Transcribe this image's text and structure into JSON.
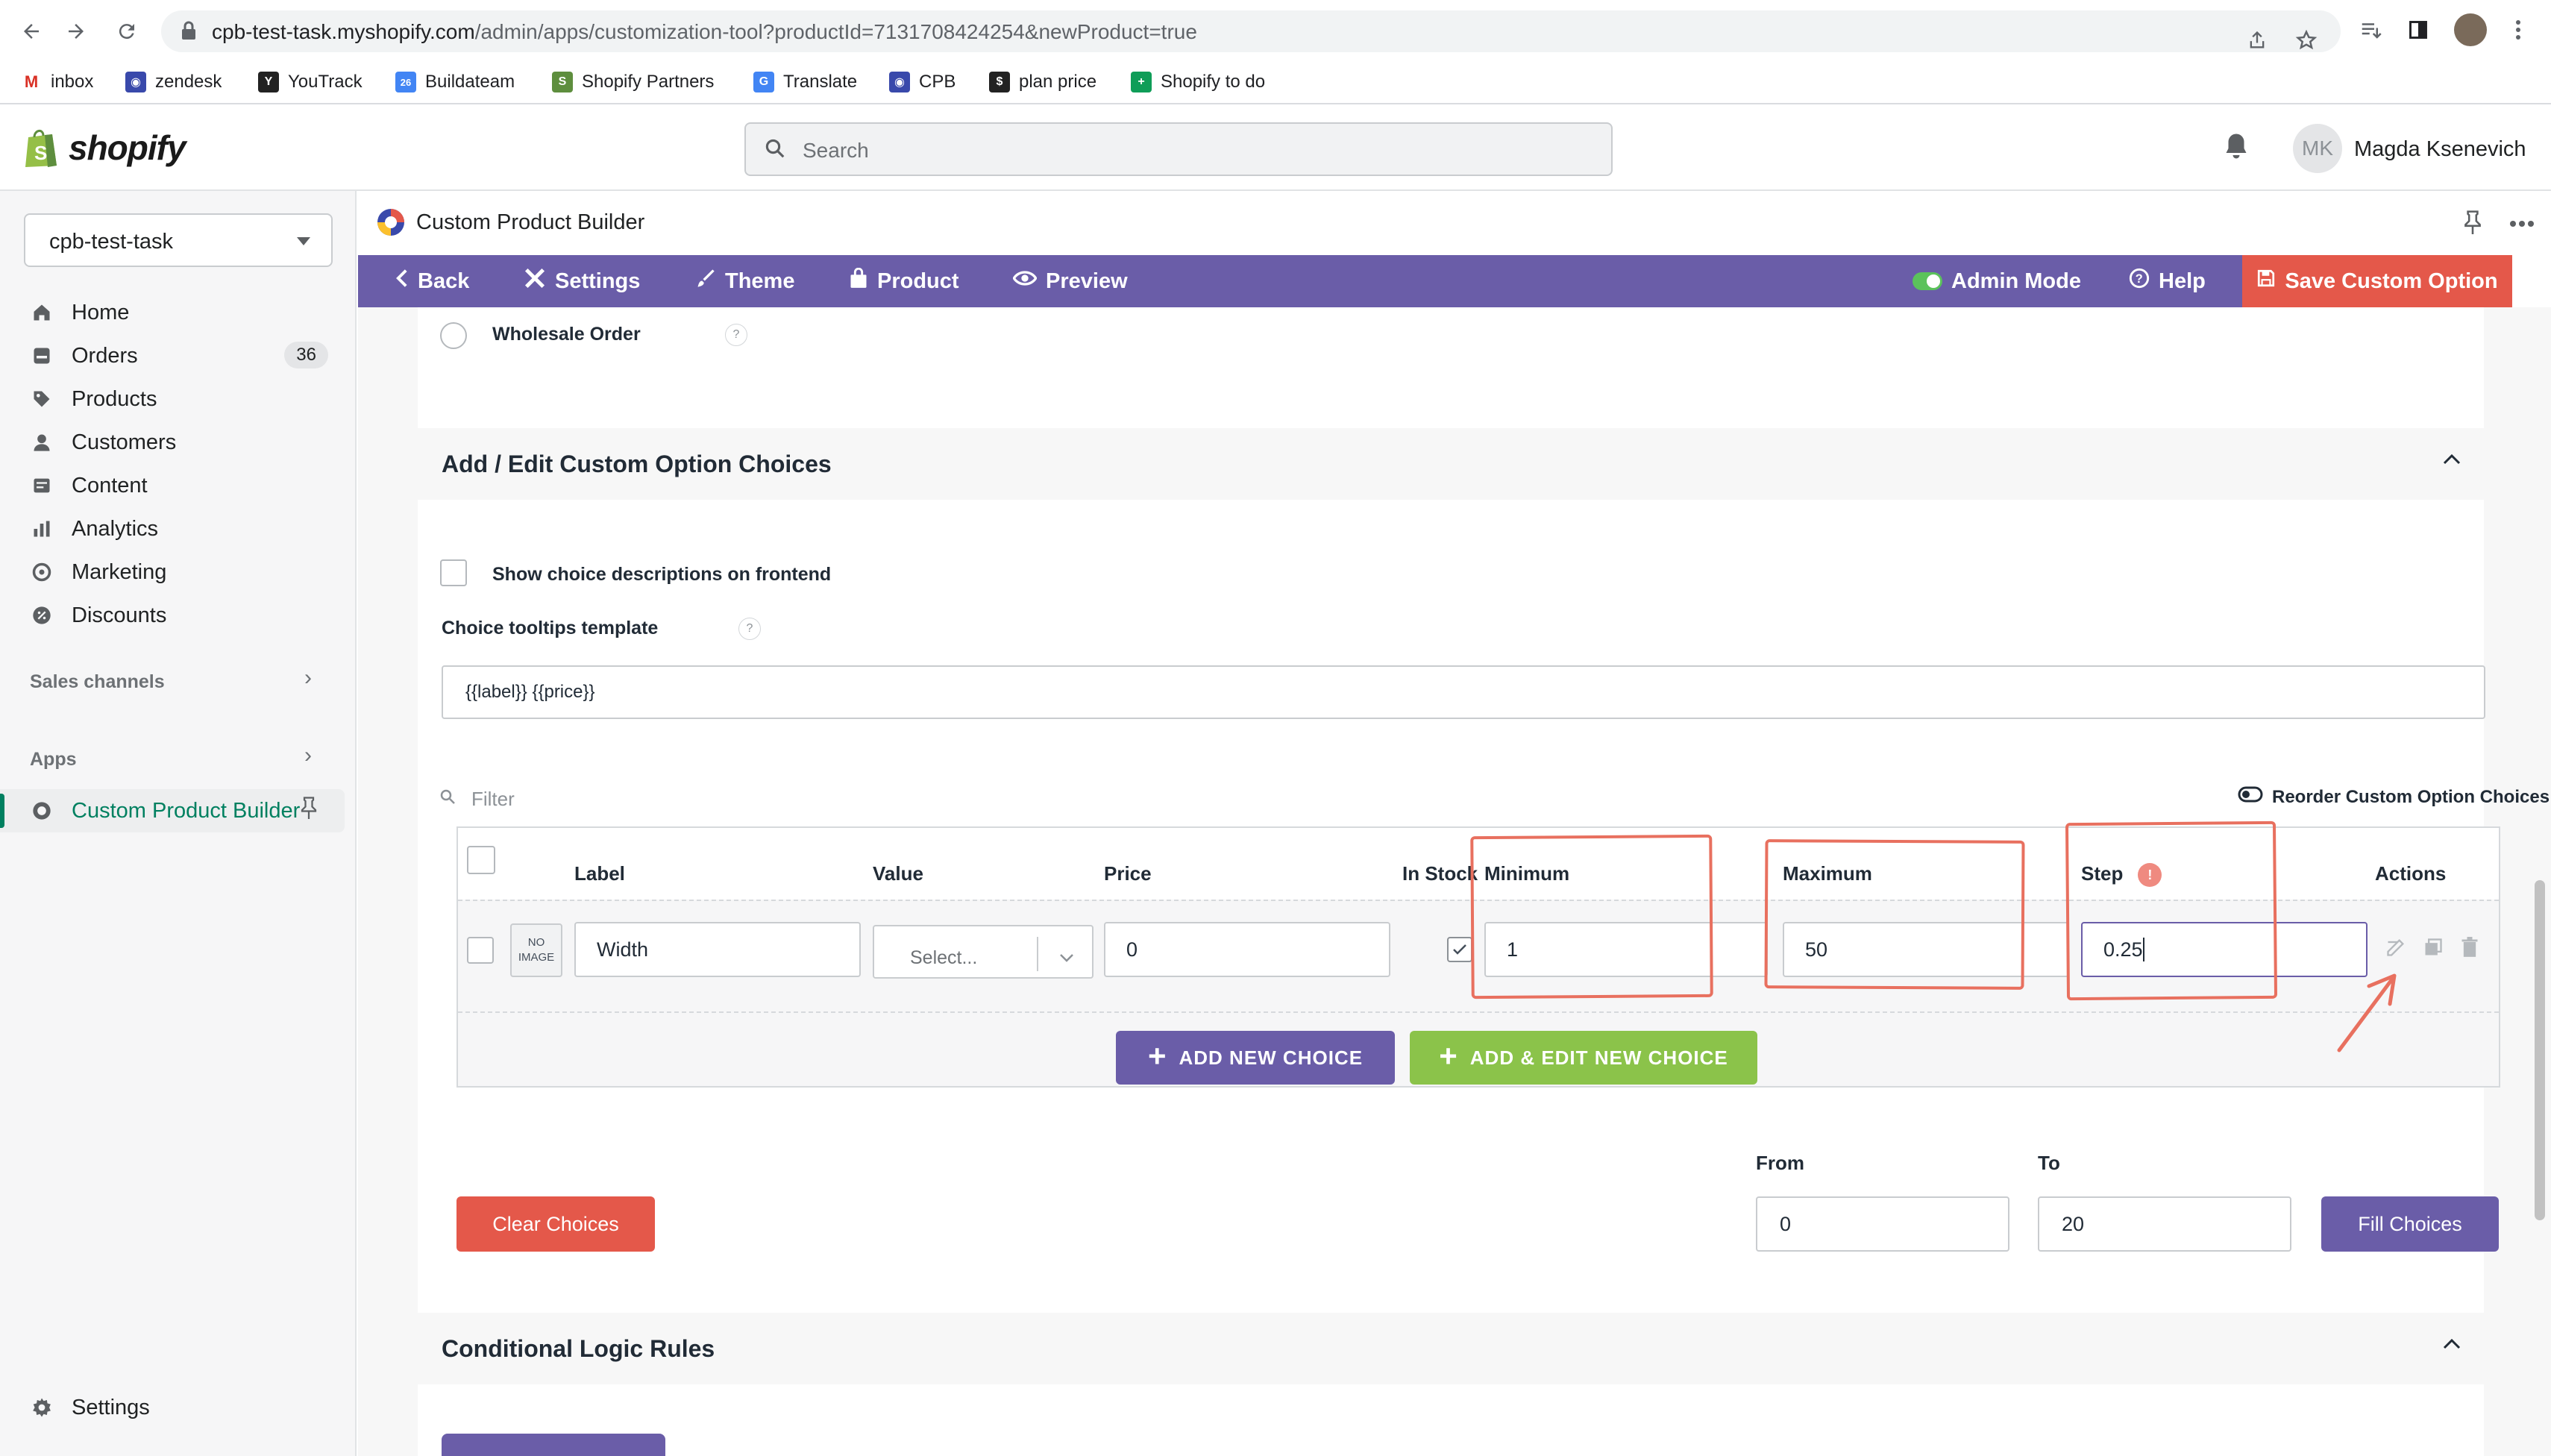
{
  "browser": {
    "url_host": "cpb-test-task.myshopify.com",
    "url_path": "/admin/apps/customization-tool?productId=7131708424254&newProduct=true",
    "bookmarks": [
      {
        "label": "inbox",
        "icon": "gmail-icon",
        "color": "#d93025"
      },
      {
        "label": "zendesk",
        "icon": "zendesk-icon",
        "color": "#3949ab"
      },
      {
        "label": "YouTrack",
        "icon": "youtrack-icon",
        "color": "#000000"
      },
      {
        "label": "Buildateam",
        "icon": "buildateam-icon",
        "color": "#4285f4"
      },
      {
        "label": "Shopify Partners",
        "icon": "shopify-icon",
        "color": "#5e8e3e"
      },
      {
        "label": "Translate",
        "icon": "translate-icon",
        "color": "#4285f4"
      },
      {
        "label": "CPB",
        "icon": "cpb-icon",
        "color": "#3949ab"
      },
      {
        "label": "plan price",
        "icon": "price-icon",
        "color": "#000000"
      },
      {
        "label": "Shopify to do",
        "icon": "sheets-icon",
        "color": "#0f9d58"
      }
    ]
  },
  "shopify": {
    "logo_text": "shopify",
    "search_placeholder": "Search",
    "user_initials": "MK",
    "user_name": "Magda Ksenevich"
  },
  "sidebar": {
    "store": "cpb-test-task",
    "items": [
      {
        "label": "Home",
        "icon": "home-icon"
      },
      {
        "label": "Orders",
        "icon": "orders-icon",
        "badge": "36"
      },
      {
        "label": "Products",
        "icon": "tag-icon"
      },
      {
        "label": "Customers",
        "icon": "person-icon"
      },
      {
        "label": "Content",
        "icon": "content-icon"
      },
      {
        "label": "Analytics",
        "icon": "bar-chart-icon"
      },
      {
        "label": "Marketing",
        "icon": "target-icon"
      },
      {
        "label": "Discounts",
        "icon": "discount-icon"
      }
    ],
    "sales_channels": "Sales channels",
    "apps": "Apps",
    "active_app": "Custom Product Builder",
    "settings": "Settings"
  },
  "app": {
    "title": "Custom Product Builder",
    "toolbar": {
      "back": "Back",
      "settings": "Settings",
      "theme": "Theme",
      "product": "Product",
      "preview": "Preview",
      "admin_mode": "Admin Mode",
      "help": "Help",
      "save": "Save Custom Option"
    }
  },
  "content": {
    "wholesale_order": "Wholesale Order",
    "choices_section_title": "Add / Edit Custom Option Choices",
    "show_descriptions": "Show choice descriptions on frontend",
    "tooltips_label": "Choice tooltips template",
    "tooltips_value": "{{label}} {{price}}",
    "filter": "Filter",
    "reorder": "Reorder Custom Option Choices",
    "columns": {
      "label": "Label",
      "value": "Value",
      "price": "Price",
      "in_stock": "In Stock",
      "minimum": "Minimum",
      "maximum": "Maximum",
      "step": "Step",
      "actions": "Actions"
    },
    "row": {
      "no_image_line1": "NO",
      "no_image_line2": "IMAGE",
      "label": "Width",
      "value_placeholder": "Select...",
      "price": "0",
      "minimum": "1",
      "maximum": "50",
      "step": "0.25"
    },
    "add_new_choice": "ADD NEW CHOICE",
    "add_edit_new_choice": "ADD & EDIT NEW CHOICE",
    "clear_choices": "Clear Choices",
    "from_label": "From",
    "from_value": "0",
    "to_label": "To",
    "to_value": "20",
    "fill_choices": "Fill Choices",
    "conditional_title": "Conditional Logic Rules"
  },
  "colors": {
    "toolbar": "#6a5da8",
    "save": "#e4584a",
    "green": "#8bc34a",
    "annotation": "#e8705f",
    "shopify_green": "#008060"
  }
}
